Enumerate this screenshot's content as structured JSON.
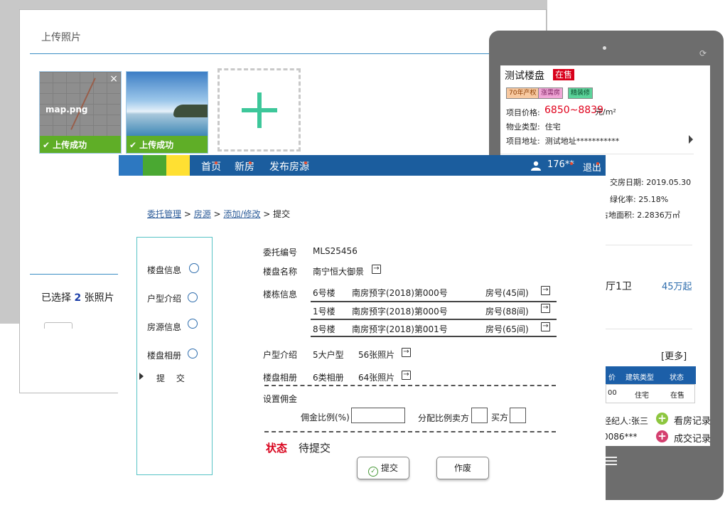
{
  "upload": {
    "title": "上传照片",
    "photos": [
      {
        "name": "map.png",
        "status": "上传成功"
      },
      {
        "name": "",
        "status": "上传成功"
      }
    ],
    "close": "×",
    "selected_prefix": "已选择",
    "selected_count": "2",
    "selected_suffix": "张照片"
  },
  "phone": {
    "name": "测试楼盘",
    "sale_badge": "在售",
    "tags": [
      "70年产权",
      "涨需房",
      "精装修"
    ],
    "price_label": "项目价格:",
    "price": "6850~8839",
    "price_unit": "元/m²",
    "type_label": "物业类型:",
    "type_value": "住宅",
    "addr_label": "项目地址:",
    "addr_value": "测试地址***********",
    "delivery": "交房日期:  2019.05.30",
    "green": "绿化率:  25.18%",
    "area": "占地面积:  2.2836万㎡",
    "layout": "厅1卫",
    "from_price": "45万起",
    "more": "[更多]",
    "table_headers": [
      "价",
      "建筑类型",
      "状态"
    ],
    "table_row": [
      "00",
      "住宅",
      "在售"
    ],
    "agent": "经纪人:张三",
    "phone_no": "0086***",
    "look_record": "看房记录",
    "deal_record": "成交记录"
  },
  "nav": {
    "home": "首页",
    "new_house": "新房",
    "publish": "发布房源",
    "user": "176**",
    "logout": "退出"
  },
  "breadcrumb": {
    "items": [
      "委托管理",
      "房源",
      "添加/修改"
    ],
    "current": "提交"
  },
  "steps": [
    "楼盘信息",
    "户型介绍",
    "房源信息",
    "楼盘相册",
    "提 交"
  ],
  "form": {
    "entrust_label": "委托编号",
    "entrust_no": "MLS25456",
    "estate_label": "楼盘名称",
    "estate_name": "南宁恒大御景",
    "building_label": "楼栋信息",
    "buildings": [
      {
        "name": "6号楼",
        "permit": "南房预字(2018)第000号",
        "rooms": "房号(45间)"
      },
      {
        "name": "1号楼",
        "permit": "南房预字(2018)第000号",
        "rooms": "房号(88间)"
      },
      {
        "name": "8号楼",
        "permit": "南房预字(2018)第001号",
        "rooms": "房号(65间)"
      }
    ],
    "layout_label": "户型介绍",
    "layout_count": "5大户型",
    "layout_photos": "56张照片",
    "album_label": "楼盘相册",
    "album_count": "6类相册",
    "album_photos": "64张照片",
    "commission_label": "设置佣金",
    "ratio_label": "佣金比例(%)",
    "split_label": "分配比例卖方",
    "buyer_label": "买方",
    "status_label": "状态",
    "status_value": "待提交",
    "submit": "提交",
    "void": "作废",
    "goto_icon": "→"
  }
}
